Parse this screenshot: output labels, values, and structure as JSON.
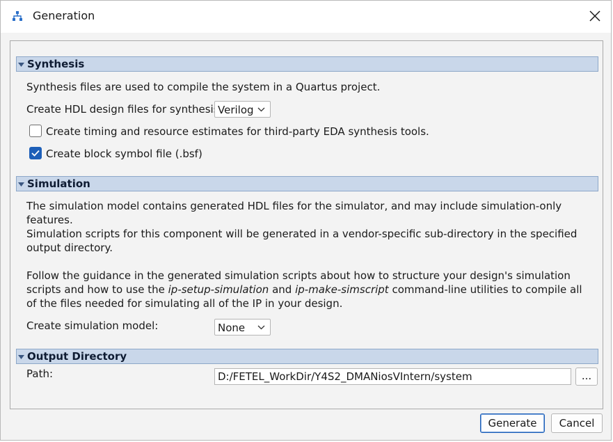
{
  "window": {
    "title": "Generation",
    "app_icon": "hierarchy-icon",
    "close_icon": "close-icon"
  },
  "synthesis": {
    "header": "Synthesis",
    "description": "Synthesis files are used to compile the system in a Quartus project.",
    "hdl_label": "Create HDL design files for synthesis:",
    "hdl_value": "Verilog",
    "timing_checkbox_label": "Create timing and resource estimates for third-party EDA synthesis tools.",
    "timing_checked": false,
    "bsf_checkbox_label": "Create block symbol file (.bsf)",
    "bsf_checked": true
  },
  "simulation": {
    "header": "Simulation",
    "para1": "The simulation model contains generated HDL files for the simulator, and may include simulation-only features.",
    "para2": "Simulation scripts for this component will be generated in a vendor-specific sub-directory in the specified output directory.",
    "para3_part1": "Follow the guidance in the generated simulation scripts about how to structure your design's simulation scripts and how to use the ",
    "para3_em1": "ip-setup-simulation",
    "para3_part2": " and ",
    "para3_em2": "ip-make-simscript",
    "para3_part3": " command-line utilities to compile all of the files needed for simulating all of the IP in your design.",
    "model_label": "Create simulation model:",
    "model_value": "None"
  },
  "output": {
    "header": "Output Directory",
    "path_label": "Path:",
    "path_value": "D:/FETEL_WorkDir/Y4S2_DMANiosVIntern/system",
    "browse_label": "..."
  },
  "buttons": {
    "generate": "Generate",
    "cancel": "Cancel"
  },
  "colors": {
    "section_header_bg": "#c9d7ea",
    "accent": "#1d5fb8"
  }
}
